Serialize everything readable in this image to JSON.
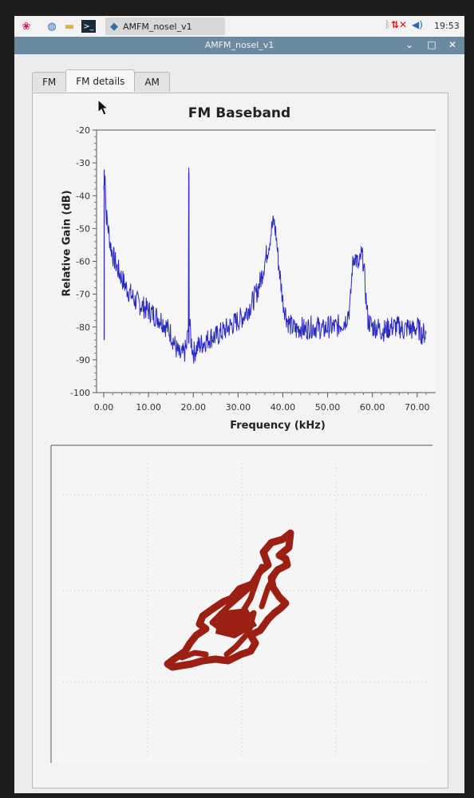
{
  "panel": {
    "taskbar_item": "AMFM_nosel_v1",
    "clock": "19:53"
  },
  "window": {
    "title": "AMFM_nosel_v1"
  },
  "tabs": [
    {
      "label": "FM"
    },
    {
      "label": "FM details",
      "active": true
    },
    {
      "label": "AM"
    }
  ],
  "chart_data": [
    {
      "type": "line",
      "title": "FM Baseband",
      "xlabel": "Frequency (kHz)",
      "ylabel": "Relative Gain (dB)",
      "xlim": [
        0,
        72
      ],
      "ylim": [
        -100,
        -20
      ],
      "xticks": [
        "0.00",
        "10.00",
        "20.00",
        "30.00",
        "40.00",
        "50.00",
        "60.00",
        "70.00"
      ],
      "yticks": [
        "-20",
        "-30",
        "-40",
        "-50",
        "-60",
        "-70",
        "-80",
        "-90",
        "-100"
      ],
      "color": "#2b2bc2",
      "series": [
        {
          "x": [
            0,
            0.3,
            0.5,
            1,
            1.5,
            2,
            3,
            4,
            5,
            6,
            7,
            8,
            9,
            10,
            11,
            12,
            13,
            14,
            15,
            16,
            17,
            18,
            18.5,
            18.9,
            19.0,
            19.1,
            19.5,
            20,
            21,
            22,
            23,
            24,
            25,
            26,
            27,
            28,
            29,
            30,
            31,
            32,
            33,
            34,
            35,
            36,
            37,
            37.5,
            38,
            38.5,
            39,
            40,
            41,
            42,
            43,
            44,
            45,
            46,
            47,
            48,
            49,
            50,
            51,
            52,
            53,
            54,
            55,
            55.5,
            56,
            56.5,
            57,
            57.5,
            58,
            58.5,
            59,
            60,
            61,
            62,
            63,
            64,
            65,
            66,
            67,
            68,
            69,
            70,
            71,
            72
          ],
          "y": [
            -38,
            -32,
            -45,
            -50,
            -55,
            -58,
            -62,
            -65,
            -68,
            -70,
            -72,
            -73,
            -74,
            -75,
            -76,
            -77,
            -78,
            -80,
            -82,
            -86,
            -89,
            -88,
            -86,
            -80,
            -33,
            -78,
            -84,
            -88,
            -86,
            -85,
            -84,
            -83,
            -83,
            -82,
            -81,
            -80,
            -79,
            -78,
            -77,
            -75,
            -73,
            -70,
            -66,
            -60,
            -54,
            -50,
            -48,
            -52,
            -60,
            -72,
            -78,
            -80,
            -81,
            -80,
            -81,
            -80,
            -80,
            -80,
            -81,
            -80,
            -80,
            -80,
            -79,
            -78,
            -74,
            -62,
            -58,
            -60,
            -62,
            -58,
            -60,
            -70,
            -78,
            -80,
            -80,
            -81,
            -81,
            -80,
            -80,
            -80,
            -81,
            -80,
            -81,
            -80,
            -82,
            -82
          ]
        }
      ]
    },
    {
      "type": "scatter",
      "title": "",
      "color": "#9b1f12"
    }
  ]
}
